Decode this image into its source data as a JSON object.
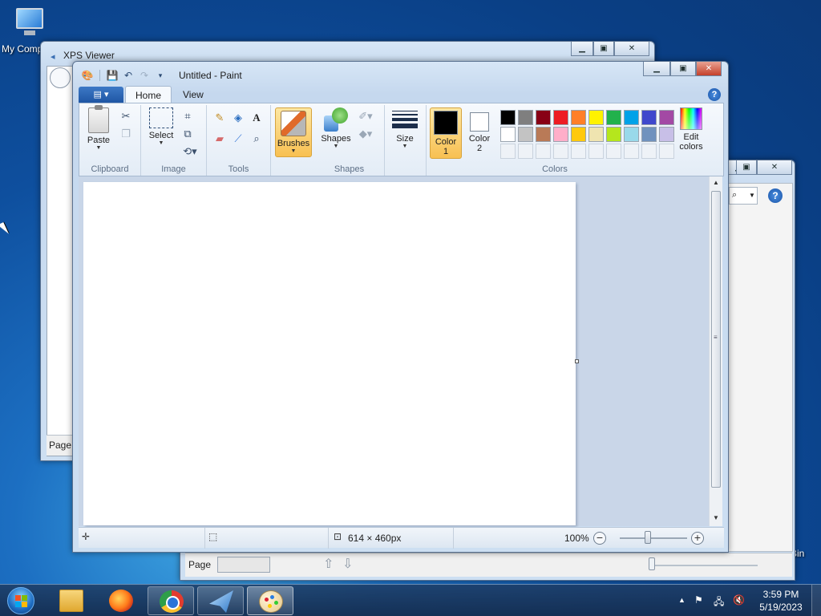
{
  "desktop": {
    "my_computer_label": "My Comp",
    "recycle_bin_label": "Bin"
  },
  "xps_back": {
    "title": "XPS Viewer",
    "page_label": "Page"
  },
  "xps_front": {
    "page_label": "Page"
  },
  "paint": {
    "title": "Untitled - Paint",
    "tabs": [
      "Home",
      "View"
    ],
    "groups": {
      "clipboard": "Clipboard",
      "image": "Image",
      "tools": "Tools",
      "shapes": "Shapes",
      "colors": "Colors"
    },
    "buttons": {
      "paste": "Paste",
      "select": "Select",
      "brushes": "Brushes",
      "shapes": "Shapes",
      "size": "Size",
      "color1_line1": "Color",
      "color1_line2": "1",
      "color2_line1": "Color",
      "color2_line2": "2",
      "edit_colors_line1": "Edit",
      "edit_colors_line2": "colors"
    },
    "color1": "#000000",
    "color2": "#ffffff",
    "palette": [
      "#000000",
      "#7f7f7f",
      "#880015",
      "#ed1c24",
      "#ff7f27",
      "#fff200",
      "#22b14c",
      "#00a2e8",
      "#3f48cc",
      "#a349a4",
      "#ffffff",
      "#c3c3c3",
      "#b97a57",
      "#ffaec9",
      "#ffc90e",
      "#efe4b0",
      "#b5e61d",
      "#99d9ea",
      "#7092be",
      "#c8bfe7",
      "",
      "",
      "",
      "",
      "",
      "",
      "",
      "",
      "",
      ""
    ],
    "status": {
      "image_size": "614 × 460px",
      "zoom": "100%",
      "zoom_minus": "−",
      "zoom_plus": "+"
    }
  },
  "taskbar": {
    "time": "3:59 PM",
    "date": "5/19/2023"
  }
}
